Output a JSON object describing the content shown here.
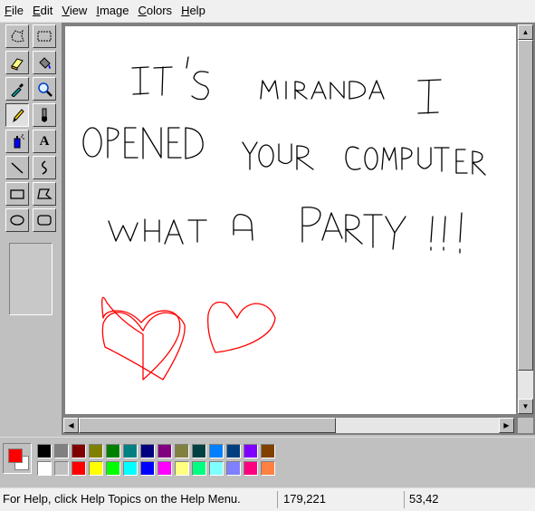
{
  "menu": [
    {
      "mnemonic": "F",
      "rest": "ile"
    },
    {
      "mnemonic": "E",
      "rest": "dit"
    },
    {
      "mnemonic": "V",
      "rest": "iew"
    },
    {
      "mnemonic": "I",
      "rest": "mage"
    },
    {
      "mnemonic": "C",
      "rest": "olors"
    },
    {
      "mnemonic": "H",
      "rest": "elp"
    }
  ],
  "tools": [
    {
      "icon": "free-form-select-icon"
    },
    {
      "icon": "rectangle-select-icon"
    },
    {
      "icon": "eraser-icon"
    },
    {
      "icon": "fill-bucket-icon"
    },
    {
      "icon": "color-picker-icon"
    },
    {
      "icon": "magnifier-icon"
    },
    {
      "icon": "pencil-icon",
      "active": true
    },
    {
      "icon": "brush-icon"
    },
    {
      "icon": "airbrush-icon"
    },
    {
      "icon": "text-icon",
      "glyph": "A"
    },
    {
      "icon": "line-icon"
    },
    {
      "icon": "curve-icon"
    },
    {
      "icon": "rectangle-icon"
    },
    {
      "icon": "polygon-icon"
    },
    {
      "icon": "ellipse-icon"
    },
    {
      "icon": "rounded-rectangle-icon"
    }
  ],
  "drawing": {
    "text_lines": [
      "IT'S MIRANDA I",
      "OPENED YOUR COMPUTER",
      "WHAT A PARTY!!!"
    ],
    "text_color": "#000000",
    "hearts_color": "#ff0000"
  },
  "current_colors": {
    "foreground": "#ff0000",
    "background": "#ffffff"
  },
  "palette_colors": [
    [
      "#000000",
      "#808080",
      "#800000",
      "#808000",
      "#008000",
      "#008080",
      "#000080",
      "#800080",
      "#808040",
      "#004040",
      "#0080ff",
      "#004080",
      "#8000ff",
      "#804000"
    ],
    [
      "#ffffff",
      "#c0c0c0",
      "#ff0000",
      "#ffff00",
      "#00ff00",
      "#00ffff",
      "#0000ff",
      "#ff00ff",
      "#ffff80",
      "#00ff80",
      "#80ffff",
      "#8080ff",
      "#ff0080",
      "#ff8040"
    ]
  ],
  "status": {
    "help": "For Help, click Help Topics on the Help Menu.",
    "position": "179,221",
    "size": "53,42"
  }
}
